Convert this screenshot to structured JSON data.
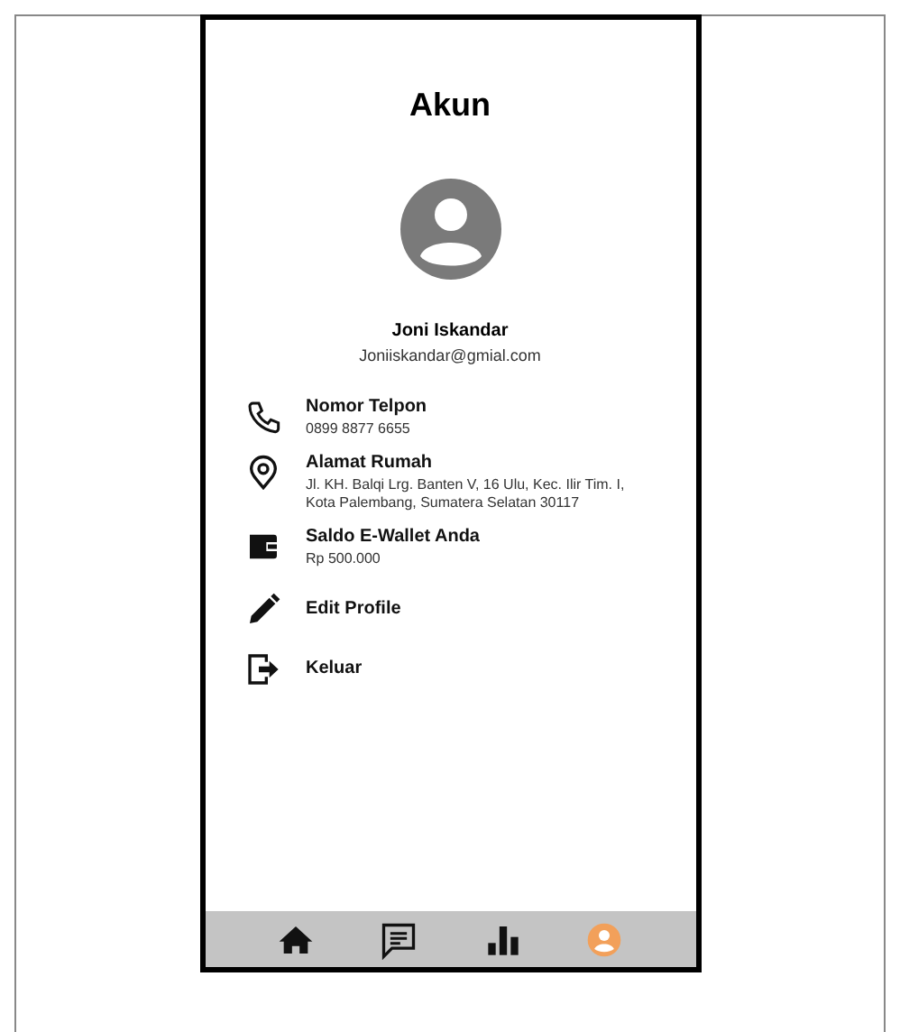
{
  "title": "Akun",
  "profile": {
    "name": "Joni Iskandar",
    "email": "Joniiskandar@gmial.com"
  },
  "details": [
    {
      "kind": "phone",
      "label": "Nomor Telpon",
      "value": [
        "0899 8877 6655"
      ]
    },
    {
      "kind": "location",
      "label": "Alamat Rumah",
      "value": [
        "Jl. KH. Balqi Lrg. Banten V, 16 Ulu, Kec. Ilir Tim. I,",
        "Kota Palembang, Sumatera Selatan 30117"
      ]
    },
    {
      "kind": "wallet",
      "label": "Saldo E-Wallet Anda",
      "value": [
        "Rp 500.000"
      ]
    }
  ],
  "actions": [
    {
      "kind": "edit",
      "label": "Edit Profile"
    },
    {
      "kind": "logout",
      "label": "Keluar"
    }
  ],
  "nav": [
    {
      "kind": "home",
      "selected": false
    },
    {
      "kind": "chat",
      "selected": false
    },
    {
      "kind": "stats",
      "selected": false
    },
    {
      "kind": "account",
      "selected": true
    }
  ]
}
